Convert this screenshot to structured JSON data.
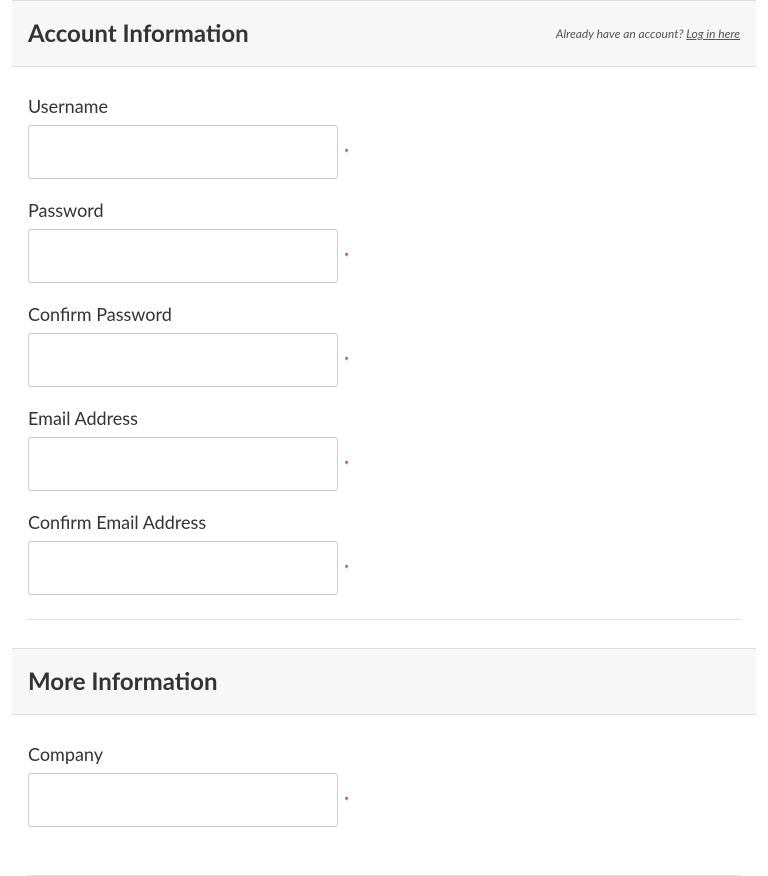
{
  "sections": {
    "account": {
      "title": "Account Information",
      "already_text": "Already have an account? ",
      "login_link": "Log in here",
      "fields": {
        "username": {
          "label": "Username",
          "value": "",
          "required": "*"
        },
        "password": {
          "label": "Password",
          "value": "",
          "required": "*"
        },
        "confirm_password": {
          "label": "Confirm Password",
          "value": "",
          "required": "*"
        },
        "email": {
          "label": "Email Address",
          "value": "",
          "required": "*"
        },
        "confirm_email": {
          "label": "Confirm Email Address",
          "value": "",
          "required": "*"
        }
      }
    },
    "more": {
      "title": "More Information",
      "fields": {
        "company": {
          "label": "Company",
          "value": "",
          "required": "*"
        }
      }
    }
  }
}
